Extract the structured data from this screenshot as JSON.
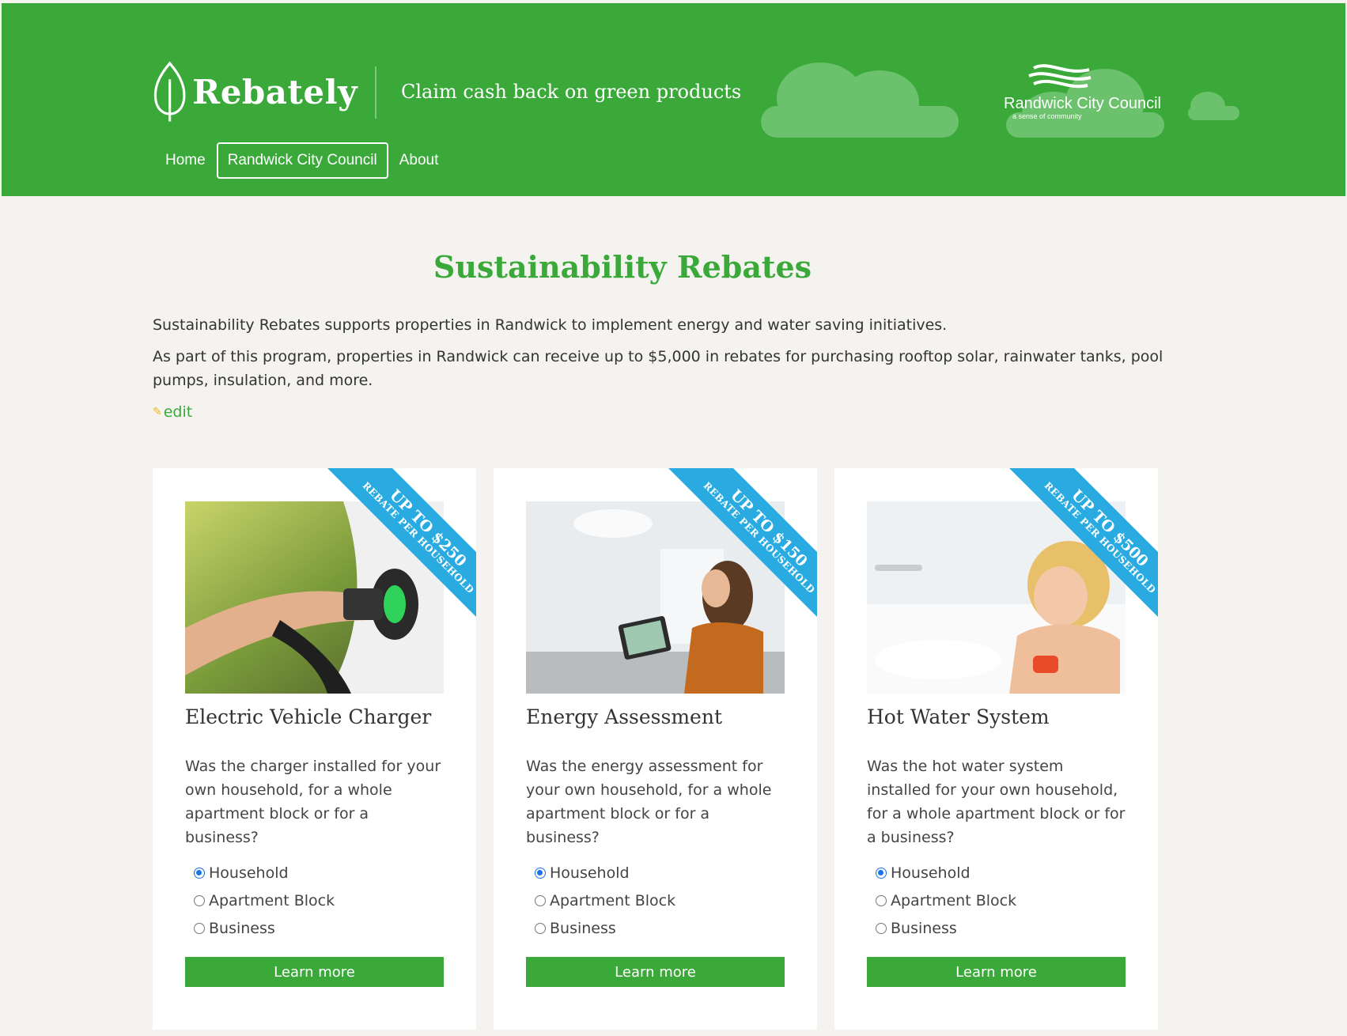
{
  "header": {
    "brand": "Rebately",
    "tagline": "Claim cash back on green products",
    "council_name": "Randwick City Council",
    "council_sub": "a sense of community",
    "nav": [
      "Home",
      "Randwick City Council",
      "About"
    ],
    "active_nav": "Randwick City Council",
    "bg_color": "#3aa93a"
  },
  "main": {
    "title": "Sustainability Rebates",
    "intro": [
      "Sustainability Rebates supports properties in Randwick to implement energy and water saving initiatives.",
      "As part of this program, properties in Randwick can receive up to $5,000 in rebates for purchasing rooftop solar, rainwater tanks, pool pumps, insulation, and more."
    ],
    "edit_label": "edit"
  },
  "cards": [
    {
      "ribbon_amount": "UP TO $250",
      "ribbon_sub": "REBATE PER HOUSEHOLD",
      "title": "Electric Vehicle Charger",
      "question": "Was the charger installed for your own household, for a whole apartment block or for a business?",
      "options": [
        "Household",
        "Apartment Block",
        "Business"
      ],
      "selected": "Household",
      "button": "Learn more"
    },
    {
      "ribbon_amount": "UP TO $150",
      "ribbon_sub": "REBATE PER HOUSEHOLD",
      "title": "Energy Assessment",
      "question": "Was the energy assessment for your own household, for a whole apartment block or for a business?",
      "options": [
        "Household",
        "Apartment Block",
        "Business"
      ],
      "selected": "Household",
      "button": "Learn more"
    },
    {
      "ribbon_amount": "UP TO $500",
      "ribbon_sub": "REBATE PER HOUSEHOLD",
      "title": "Hot Water System",
      "question": "Was the hot water system installed for your own household, for a whole apartment block or for a business?",
      "options": [
        "Household",
        "Apartment Block",
        "Business"
      ],
      "selected": "Household",
      "button": "Learn more"
    }
  ],
  "colors": {
    "accent": "#3aa93a",
    "ribbon": "#29abe2"
  }
}
